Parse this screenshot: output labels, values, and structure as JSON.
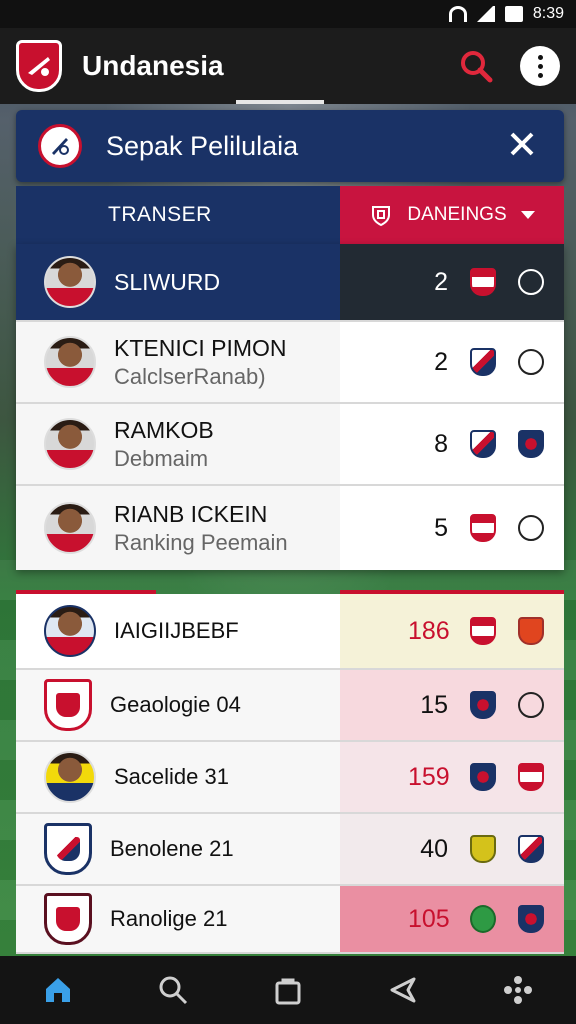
{
  "status_bar": {
    "time": "8:39"
  },
  "app_bar": {
    "title": "Undanesia"
  },
  "header": {
    "title": "Sepak Pelilulaia"
  },
  "tabs": {
    "left_label": "TRANSER",
    "right_label": "DANEINGS"
  },
  "top_list": [
    {
      "name": "SLIWURD",
      "sub": "",
      "value": "2"
    },
    {
      "name": "KTENICI PIMON",
      "sub": "CalclserRanab)",
      "value": "2"
    },
    {
      "name": "RAMKOB",
      "sub": "Debmaim",
      "value": "8"
    },
    {
      "name": "RIANB ICKEIN",
      "sub": "Ranking Peemain",
      "value": "5"
    }
  ],
  "bottom_list": [
    {
      "name": "IAIGIIJBEBF",
      "value": "186"
    },
    {
      "name": "Geaologie 04",
      "value": "15"
    },
    {
      "name": "Sacelide 31",
      "value": "159"
    },
    {
      "name": "Benolene 21",
      "value": "40"
    },
    {
      "name": "Ranolige 21",
      "value": "105"
    }
  ],
  "colors": {
    "navy": "#1a3266",
    "accent_red": "#c8102e",
    "tab_red": "#c8143f",
    "bar_dark": "#1c1c1c"
  },
  "icons": [
    "search-icon",
    "more-icon",
    "close-icon",
    "home-icon",
    "search-nav-icon",
    "bag-icon",
    "back-icon",
    "apps-icon"
  ]
}
